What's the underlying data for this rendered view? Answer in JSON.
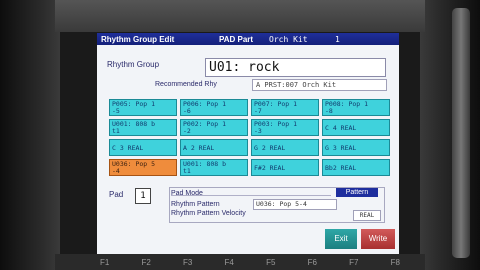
{
  "title_bar": {
    "title": "Rhythm Group Edit",
    "part": "PAD Part",
    "kit": "Orch Kit",
    "number": "1"
  },
  "rhythm_group": {
    "label": "Rhythm Group",
    "value": "U01: rock"
  },
  "recommended": {
    "label": "Recommended Rhy",
    "value": "A PRST:007 Orch Kit"
  },
  "pads": [
    {
      "line1": "P005: Pop 1",
      "line2": "-5"
    },
    {
      "line1": "P006: Pop 1",
      "line2": "-6"
    },
    {
      "line1": "P007: Pop 1",
      "line2": "-7"
    },
    {
      "line1": "P008: Pop 1",
      "line2": "-8"
    },
    {
      "line1": "U001: 808 b",
      "line2": "t1"
    },
    {
      "line1": "P002: Pop 1",
      "line2": "-2"
    },
    {
      "line1": "P003: Pop 1",
      "line2": "-3"
    },
    {
      "line1": "C 4  REAL",
      "line2": ""
    },
    {
      "line1": "C 3  REAL",
      "line2": ""
    },
    {
      "line1": "A 2  REAL",
      "line2": ""
    },
    {
      "line1": "G 2  REAL",
      "line2": ""
    },
    {
      "line1": "G 3  REAL",
      "line2": ""
    },
    {
      "line1": "U036: Pop 5",
      "line2": "-4"
    },
    {
      "line1": "U001: 808 b",
      "line2": "t1"
    },
    {
      "line1": "F#2  REAL",
      "line2": ""
    },
    {
      "line1": "Bb2  REAL",
      "line2": ""
    }
  ],
  "pad_selector": {
    "label": "Pad",
    "value": "1"
  },
  "pad_mode": {
    "label": "Pad Mode",
    "value": "Pattern",
    "pattern_label": "Rhythm Pattern",
    "pattern_value": "U036: Pop 5-4",
    "velocity_label": "Rhythm Pattern Velocity",
    "velocity_value": "REAL"
  },
  "buttons": {
    "exit": "Exit",
    "write": "Write"
  },
  "function_keys": [
    "F1",
    "F2",
    "F3",
    "F4",
    "F5",
    "F6",
    "F7",
    "F8"
  ],
  "colors": {
    "title_bar": "#1f2f9a",
    "pad": "#3fd2dc",
    "pad_selected": "#ef8c3c",
    "exit": "#2ea7a7",
    "write": "#d25a5a"
  }
}
